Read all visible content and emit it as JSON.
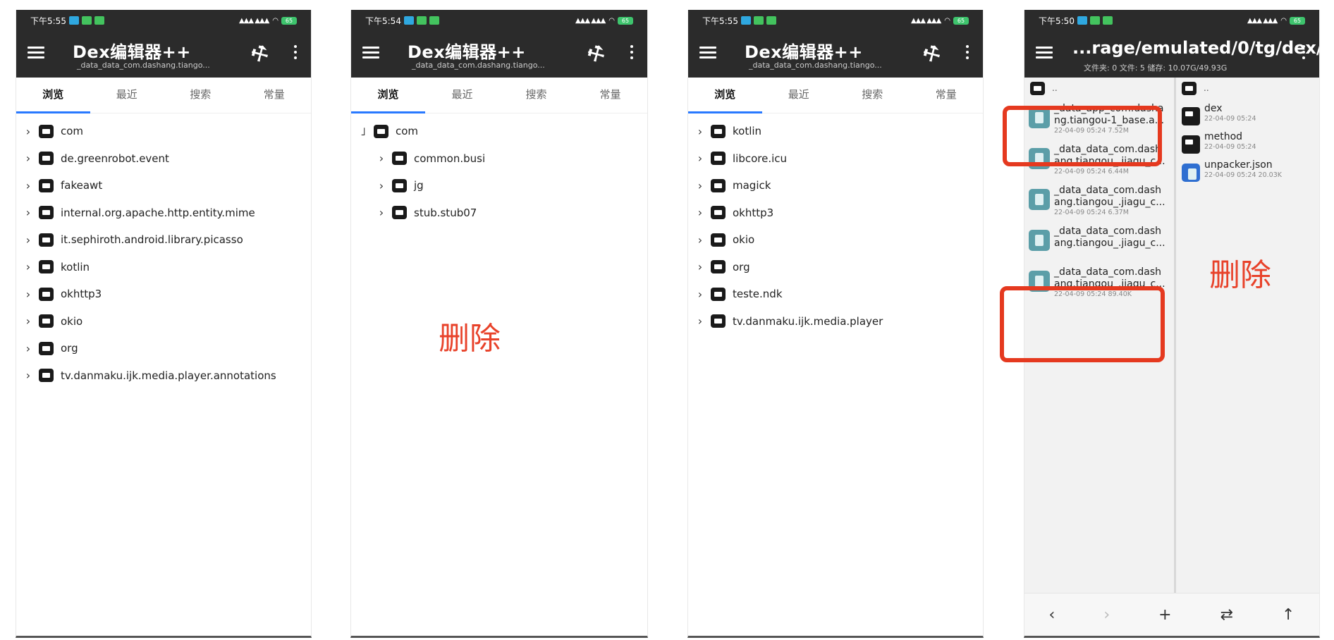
{
  "status": {
    "time1": "下午5:55",
    "time2": "下午5:54",
    "time3": "下午5:55",
    "time4": "下午5:50",
    "signal": "▲▲▲ ▲▲▲",
    "battery": "65"
  },
  "app": {
    "title": "Dex编辑器++",
    "subtitle": "_data_data_com.dashang.tiango..."
  },
  "tabs": [
    "浏览",
    "最近",
    "搜索",
    "常量"
  ],
  "panel1": {
    "items": [
      "com",
      "de.greenrobot.event",
      "fakeawt",
      "internal.org.apache.http.entity.mime",
      "it.sephiroth.android.library.picasso",
      "kotlin",
      "okhttp3",
      "okio",
      "org",
      "tv.danmaku.ijk.media.player.annotations"
    ]
  },
  "panel2": {
    "root": "com",
    "children": [
      "common.busi",
      "jg",
      "stub.stub07"
    ],
    "annotation": "删除"
  },
  "panel3": {
    "items": [
      "kotlin",
      "libcore.icu",
      "magick",
      "okhttp3",
      "okio",
      "org",
      "teste.ndk",
      "tv.danmaku.ijk.media.player"
    ]
  },
  "panel4": {
    "title": "...rage/emulated/0/tg/dex/",
    "subtitle": "文件夹: 0  文件: 5  储存: 10.07G/49.93G",
    "up": "..",
    "left_files": [
      {
        "name1": "_data_app_com.dasha",
        "name2": "ng.tiangou-1_base.a...",
        "meta": "22-04-09 05:24  7.52M"
      },
      {
        "name1": "_data_data_com.dash",
        "name2": "ang.tiangou_.jiagu_c...",
        "meta": "22-04-09 05:24  6.44M"
      },
      {
        "name1": "_data_data_com.dash",
        "name2": "ang.tiangou_.jiagu_c...",
        "meta": "22-04-09 05:24  6.37M"
      },
      {
        "name1": "_data_data_com.dash",
        "name2": "ang.tiangou_.jiagu_c...",
        "meta": ""
      },
      {
        "name1": "_data_data_com.dash",
        "name2": "ang.tiangou_.jiagu_c...",
        "meta": "22-04-09 05:24  89.40K"
      }
    ],
    "right_items": [
      {
        "name": "dex",
        "meta": "22-04-09 05:24"
      },
      {
        "name": "method",
        "meta": "22-04-09 05:24"
      },
      {
        "name": "unpacker.json",
        "meta": "22-04-09 05:24  20.03K"
      }
    ],
    "annotation": "删除",
    "bottom_nav": [
      "‹",
      "›",
      "+",
      "⇄",
      "↑"
    ]
  }
}
